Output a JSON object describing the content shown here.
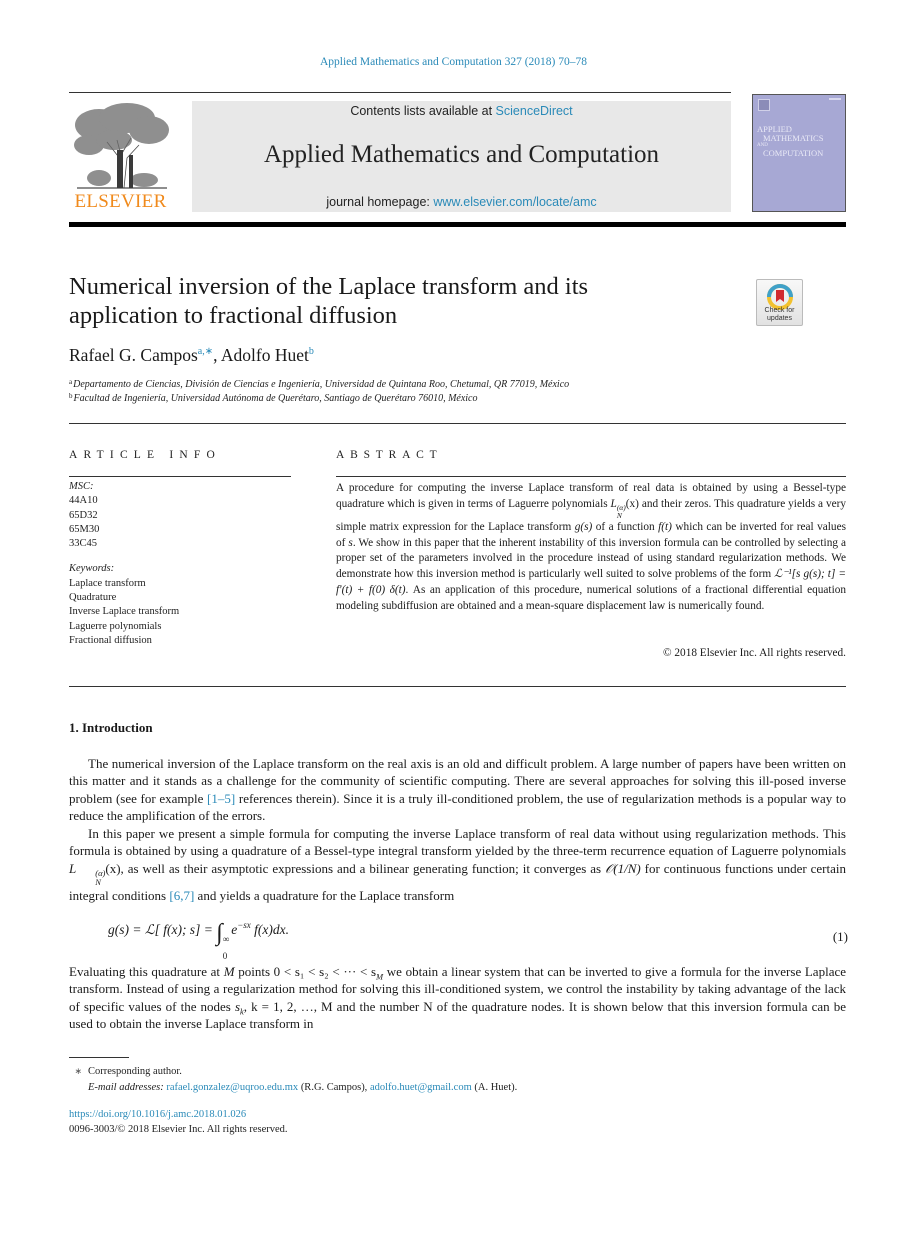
{
  "citation": "Applied Mathematics and Computation 327 (2018) 70–78",
  "header": {
    "publisher_logo_text": "ELSEVIER",
    "contents_prefix": "Contents lists available at ",
    "contents_link": "ScienceDirect",
    "journal_name": "Applied Mathematics and Computation",
    "homepage_prefix": "journal homepage: ",
    "homepage_link": "www.elsevier.com/locate/amc",
    "cover_lines": [
      "APPLIED",
      "MATHEMATICS",
      "AND",
      "COMPUTATION"
    ]
  },
  "check_updates": {
    "label_line1": "Check for",
    "label_line2": "updates"
  },
  "paper": {
    "title_line1": "Numerical inversion of the Laplace transform and its",
    "title_line2": "application to fractional diffusion",
    "authors": [
      {
        "name": "Rafael G. Campos",
        "marks": "a,∗"
      },
      {
        "name": "Adolfo Huet",
        "marks": "b"
      }
    ],
    "author_separator": ", ",
    "affiliations": [
      {
        "mark": "a",
        "text": "Departamento de Ciencias, División de Ciencias e Ingeniería, Universidad de Quintana Roo, Chetumal, QR 77019, México"
      },
      {
        "mark": "b",
        "text": "Facultad de Ingeniería, Universidad Autónoma de Querétaro, Santiago de Querétaro 76010, México"
      }
    ]
  },
  "article_info": {
    "heading": "ARTICLE INFO",
    "msc_label": "MSC:",
    "msc": [
      "44A10",
      "65D32",
      "65M30",
      "33C45"
    ],
    "keywords_label": "Keywords:",
    "keywords": [
      "Laplace transform",
      "Quadrature",
      "Inverse Laplace transform",
      "Laguerre polynomials",
      "Fractional diffusion"
    ]
  },
  "abstract": {
    "heading": "ABSTRACT",
    "part1": "A procedure for computing the inverse Laplace transform of real data is obtained by using a Bessel-type quadrature which is given in terms of Laguerre polynomials ",
    "laguerre": "L",
    "laguerre_sup": "(α)",
    "laguerre_sub": "N",
    "laguerre_arg": "(x)",
    "part2": " and their zeros. This quadrature yields a very simple matrix expression for the Laplace transform ",
    "gs": "g(s)",
    "part3": " of a function ",
    "ft": "f(t)",
    "part4": " which can be inverted for real values of ",
    "s": "s",
    "part5": ". We show in this paper that the inherent instability of this inversion formula can be controlled by selecting a proper set of the parameters involved in the procedure instead of using standard regularization methods. We demonstrate how this inversion method is particularly well suited to solve problems of the form ",
    "formula": "ℒ⁻¹[s g(s); t] = f′(t) + f(0) δ(t)",
    "part6": ". As an application of this procedure, numerical solutions of a fractional differential equation modeling subdiffusion are obtained and a mean-square displacement law is numerically found.",
    "copyright": "© 2018 Elsevier Inc. All rights reserved."
  },
  "introduction": {
    "heading": "1. Introduction",
    "p1_a": "The numerical inversion of the Laplace transform on the real axis is an old and difficult problem. A large number of papers have been written on this matter and it stands as a challenge for the community of scientific computing. There are several approaches for solving this ill-posed inverse problem (see for example ",
    "p1_ref": "[1–5]",
    "p1_b": " references therein). Since it is a truly ill-conditioned problem, the use of regularization methods is a popular way to reduce the amplification of the errors.",
    "p2_a": "In this paper we present a simple formula for computing the inverse Laplace transform of real data without using regularization methods. This formula is obtained by using a quadrature of a Bessel-type integral transform yielded by the three-term recurrence equation of Laguerre polynomials ",
    "p2_b": ", as well as their asymptotic expressions and a bilinear generating function; it converges as ",
    "p2_order": "𝒪(1/N)",
    "p2_c": " for continuous functions under certain integral conditions ",
    "p2_ref": "[6,7]",
    "p2_d": " and yields a quadrature for the Laplace transform",
    "equation_lhs": "g(s) = ℒ[ f(x); s] = ",
    "equation_integral": "∫",
    "equation_upper": "∞",
    "equation_lower": "0",
    "equation_rhs_e": "e",
    "equation_rhs_exp": "−sx",
    "equation_rhs_rest": " f(x)dx.",
    "equation_number": "(1)",
    "p3_a": "Evaluating this quadrature at ",
    "p3_M": "M",
    "p3_b": " points 0 < s₁ < s₂ < ··· < s",
    "p3_c": " we obtain a linear system that can be inverted to give a formula for the inverse Laplace transform. Instead of using a regularization method for solving this ill-conditioned system, we control the instability by taking advantage of the lack of specific values of the nodes ",
    "p3_sk": "s",
    "p3_d": ", k = 1, 2, …, M and the number N of the quadrature nodes. It is shown below that this inversion formula can be used to obtain the inverse Laplace transform in"
  },
  "footnotes": {
    "star": "∗",
    "corresponding": "Corresponding author.",
    "email_label": "E-mail addresses:",
    "email1": "rafael.gonzalez@uqroo.edu.mx",
    "email1_owner": " (R.G. Campos), ",
    "email2": "adolfo.huet@gmail.com",
    "email2_owner": " (A. Huet).",
    "doi": "https://doi.org/10.1016/j.amc.2018.01.026",
    "issn_copyright": "0096-3003/© 2018 Elsevier Inc. All rights reserved."
  }
}
